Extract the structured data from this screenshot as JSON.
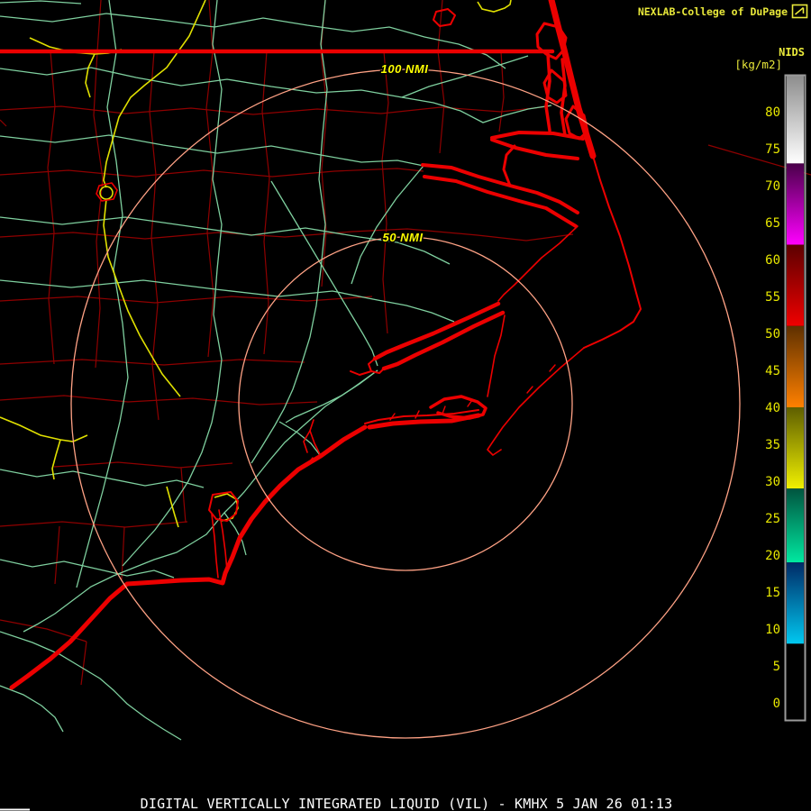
{
  "header": {
    "brand": "NEXLAB-College of DuPage",
    "logo_icon": "cod-flag-icon"
  },
  "colorbar": {
    "title": "NIDS",
    "units": "[kg/m2]",
    "tick_values": [
      80,
      75,
      70,
      65,
      60,
      55,
      50,
      45,
      40,
      35,
      30,
      25,
      20,
      15,
      10,
      5,
      0
    ],
    "segments": [
      {
        "top_value": 85,
        "bottom_value": 73,
        "top_color": "#8c8c8c",
        "bottom_color": "#ffffff"
      },
      {
        "top_value": 73,
        "bottom_value": 62,
        "top_color": "#4a004a",
        "bottom_color": "#ff00ff"
      },
      {
        "top_value": 62,
        "bottom_value": 51,
        "top_color": "#5c0000",
        "bottom_color": "#f00000"
      },
      {
        "top_value": 51,
        "bottom_value": 40,
        "top_color": "#5e3000",
        "bottom_color": "#ff8000"
      },
      {
        "top_value": 40,
        "bottom_value": 29,
        "top_color": "#5e5e00",
        "bottom_color": "#f0f000"
      },
      {
        "top_value": 29,
        "bottom_value": 19,
        "top_color": "#00543f",
        "bottom_color": "#00e8a0"
      },
      {
        "top_value": 19,
        "bottom_value": 8,
        "top_color": "#002a66",
        "bottom_color": "#00c8f0"
      },
      {
        "top_value": 8,
        "bottom_value": -2,
        "top_color": "#000000",
        "bottom_color": "#000000"
      }
    ]
  },
  "rings": [
    {
      "label": "50 NMI",
      "radius_nmi": 50
    },
    {
      "label": "100 NMI",
      "radius_nmi": 100
    }
  ],
  "footer": {
    "product_line": "DIGITAL VERTICALLY INTEGRATED LIQUID (VIL) - KMHX 5 JAN 26 01:13"
  },
  "palette": {
    "background": "#000000",
    "coastline_red": "#ec0000",
    "county_dark_red": "#8f0000",
    "road_green": "#7fd09f",
    "highway_yellow": "#e0e000",
    "range_ring_salmon": "#ffa285",
    "nmi_label_yellow": "#ffff00",
    "brand_yellow": "#e8e83a",
    "scale_label_yellow": "#e8e800",
    "footer_white": "#ffffff",
    "colorbar_border_gray": "#9a9a9a"
  }
}
